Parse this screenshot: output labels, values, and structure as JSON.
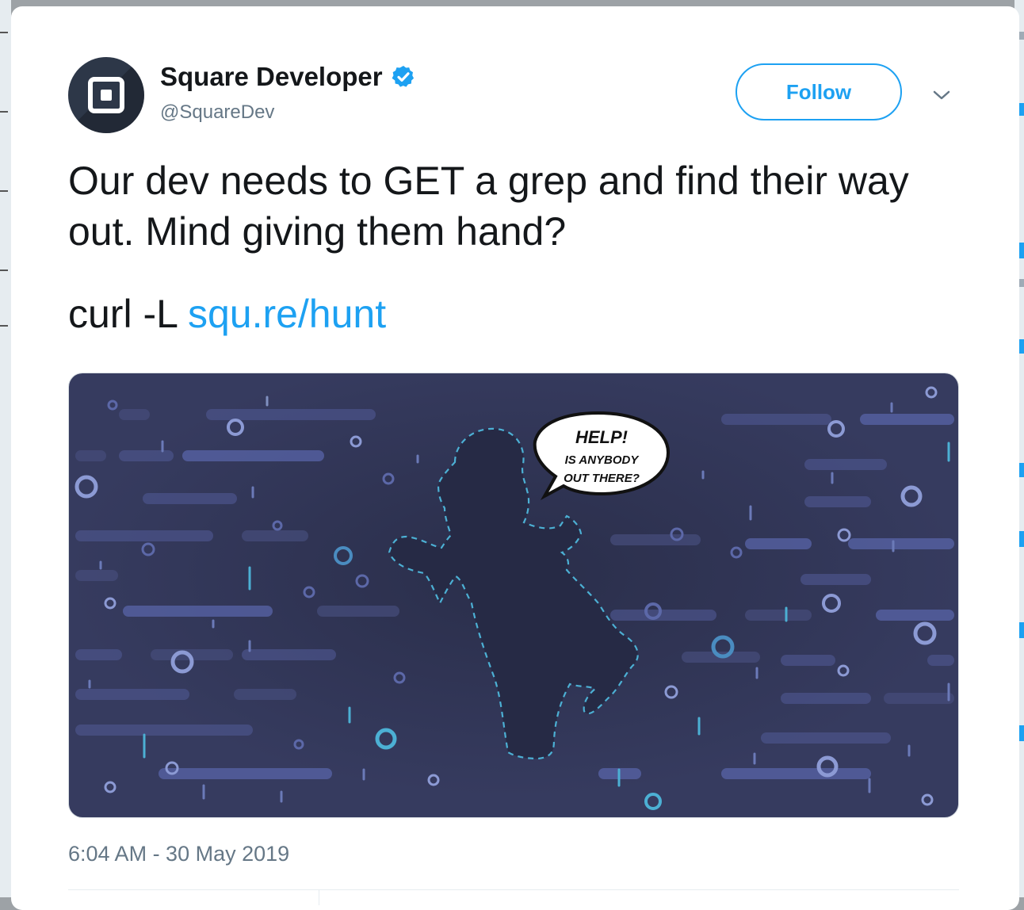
{
  "tweet": {
    "author": {
      "display_name": "Square Developer",
      "handle": "@SquareDev",
      "verified": true,
      "avatar_icon": "square-logo-icon"
    },
    "follow_label": "Follow",
    "text_line1": "Our dev needs to GET a grep and find their way out. Mind giving them hand?",
    "text_line2_prefix": "curl -L ",
    "link_text": "squ.re/hunt",
    "image": {
      "bubble_line1": "HELP!",
      "bubble_line2": "IS ANYBODY",
      "bubble_line3": "OUT THERE?"
    },
    "timestamp": "6:04 AM - 30 May 2019"
  },
  "colors": {
    "accent": "#1da1f2",
    "text": "#14171a",
    "muted": "#657786",
    "image_bg": "#2c3050"
  }
}
